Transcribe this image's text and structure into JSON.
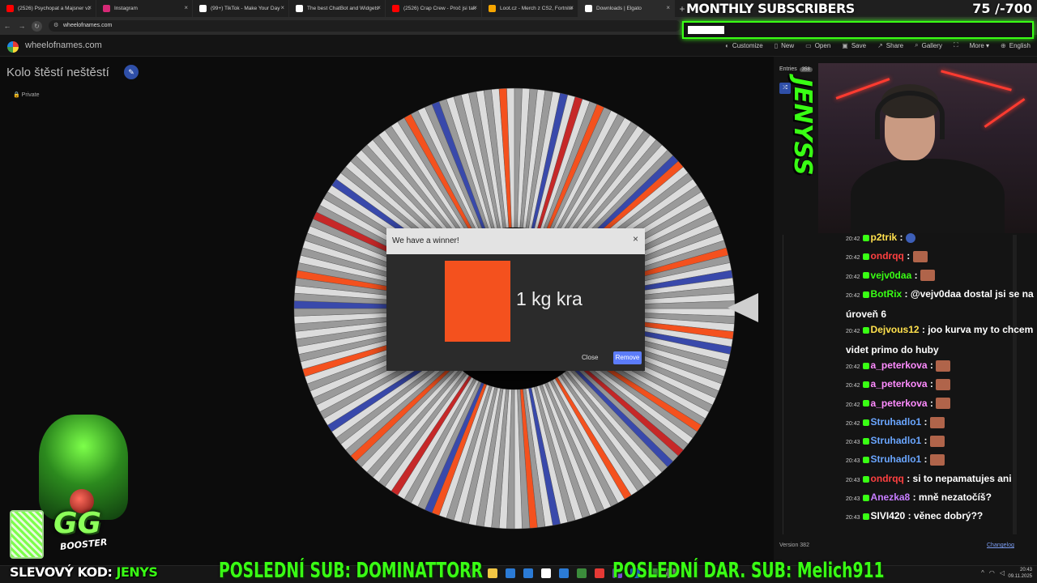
{
  "browser": {
    "tabs": [
      {
        "label": "(2526) Psychopat a Majsner vz",
        "favicon_color": "#ff0000",
        "active": false
      },
      {
        "label": "Instagram",
        "favicon_color": "#d62976",
        "active": false
      },
      {
        "label": "(99+) TikTok - Make Your Day",
        "favicon_color": "#ffffff",
        "active": false
      },
      {
        "label": "The best ChatBot and Widgets",
        "favicon_color": "#ffffff",
        "active": false
      },
      {
        "label": "(2526) Crap Crew - Proč jsi tak",
        "favicon_color": "#ff0000",
        "active": false
      },
      {
        "label": "Loot.cz - Merch z CS2, Fortnite",
        "favicon_color": "#f7a600",
        "active": false
      },
      {
        "label": "Downloads | Elgato",
        "favicon_color": "#ffffff",
        "active": true
      }
    ],
    "url": "wheelofnames.com"
  },
  "sub_goal": {
    "title": "MONTHLY SUBSCRIBERS",
    "current": "75",
    "target": "700",
    "count_text": "75 /-700",
    "progress": 0.107,
    "accent": "#39ff14"
  },
  "site": {
    "name": "wheelofnames.com",
    "menu": [
      {
        "icon": "palette-icon",
        "glyph": "◐",
        "label": "Customize"
      },
      {
        "icon": "new-file-icon",
        "glyph": "▯",
        "label": "New"
      },
      {
        "icon": "folder-open-icon",
        "glyph": "▭",
        "label": "Open"
      },
      {
        "icon": "save-icon",
        "glyph": "▣",
        "label": "Save"
      },
      {
        "icon": "share-icon",
        "glyph": "↗",
        "label": "Share"
      },
      {
        "icon": "search-icon",
        "glyph": "⌕",
        "label": "Gallery"
      },
      {
        "icon": "fullscreen-icon",
        "glyph": "⛶",
        "label": ""
      },
      {
        "icon": "chevron-down-icon",
        "glyph": "",
        "label": "More ▾"
      },
      {
        "icon": "globe-icon",
        "glyph": "⊕",
        "label": "English"
      }
    ]
  },
  "wheel": {
    "title": "Kolo štěstí neštěstí",
    "privacy": "Private",
    "segments_accent": [
      "#f4511e",
      "#3949ab",
      "#c62828"
    ]
  },
  "dialog": {
    "title": "We have a winner!",
    "winner": "1 kg kra",
    "color": "#f4511e",
    "close_label": "Close",
    "remove_label": "Remove"
  },
  "panel": {
    "entries_label": "Entries",
    "entries_count": "358",
    "version": "Version 382",
    "changelog": "Changelog"
  },
  "stream": {
    "name_vertical": "JENYSS",
    "chat": [
      {
        "time": "20:42",
        "user": "p2trik",
        "color": "#ffe14d",
        "text": ":",
        "emote": "blue"
      },
      {
        "time": "20:42",
        "user": "ondrqq",
        "color": "#ff4040",
        "text": ":",
        "emote": "brown"
      },
      {
        "time": "20:42",
        "user": "vejv0daa",
        "color": "#39ff14",
        "text": ":",
        "emote": "brown"
      },
      {
        "time": "20:42",
        "user": "BotRix",
        "color": "#39ff14",
        "text": ": @vejv0daa dostal jsi se na úroveň 6",
        "emote": ""
      },
      {
        "time": "20:42",
        "user": "Dejvous12",
        "color": "#ffe14d",
        "text": ": joo kurva my to chcem videt primo do huby",
        "emote": ""
      },
      {
        "time": "20:42",
        "user": "a_peterkova",
        "color": "#ff8cff",
        "text": ":",
        "emote": "brown"
      },
      {
        "time": "20:42",
        "user": "a_peterkova",
        "color": "#ff8cff",
        "text": ":",
        "emote": "brown"
      },
      {
        "time": "20:42",
        "user": "a_peterkova",
        "color": "#ff8cff",
        "text": ":",
        "emote": "brown"
      },
      {
        "time": "20:42",
        "user": "Struhadlo1",
        "color": "#6aa6ff",
        "text": ":",
        "emote": "brown"
      },
      {
        "time": "20:43",
        "user": "Struhadlo1",
        "color": "#6aa6ff",
        "text": ":",
        "emote": "brown"
      },
      {
        "time": "20:43",
        "user": "Struhadlo1",
        "color": "#6aa6ff",
        "text": ":",
        "emote": "brown"
      },
      {
        "time": "20:43",
        "user": "ondrqq",
        "color": "#ff4040",
        "text": ": si to nepamatujes ani",
        "emote": ""
      },
      {
        "time": "20:43",
        "user": "Anezka8",
        "color": "#c77dff",
        "text": ": mně nezatočíš?",
        "emote": ""
      },
      {
        "time": "20:43",
        "user": "SIVI420",
        "color": "#ffffff",
        "text": ": věnec dobrý??",
        "emote": ""
      }
    ],
    "promo_label": "SLEVOVÝ KOD:",
    "promo_code": "JENYS",
    "ticker_sub": "POSLEDNÍ SUB: DOMINATTORR",
    "ticker_gift": "POSLEDNÍ DAR. SUB: Melich911",
    "booster_big": "GG",
    "booster_small": "BOOSTER"
  },
  "taskbar": {
    "time": "20:43",
    "date": "09.11.2025",
    "icons": [
      "#3a3a3a",
      "#f2c744",
      "#2b7bd6",
      "#2b7bd6",
      "#ffffff",
      "#2b7bd6",
      "#3b8c3b",
      "#e53935",
      "#7a4bd6",
      "#1e6bd6",
      "#3a9a3a",
      "#888888"
    ]
  }
}
